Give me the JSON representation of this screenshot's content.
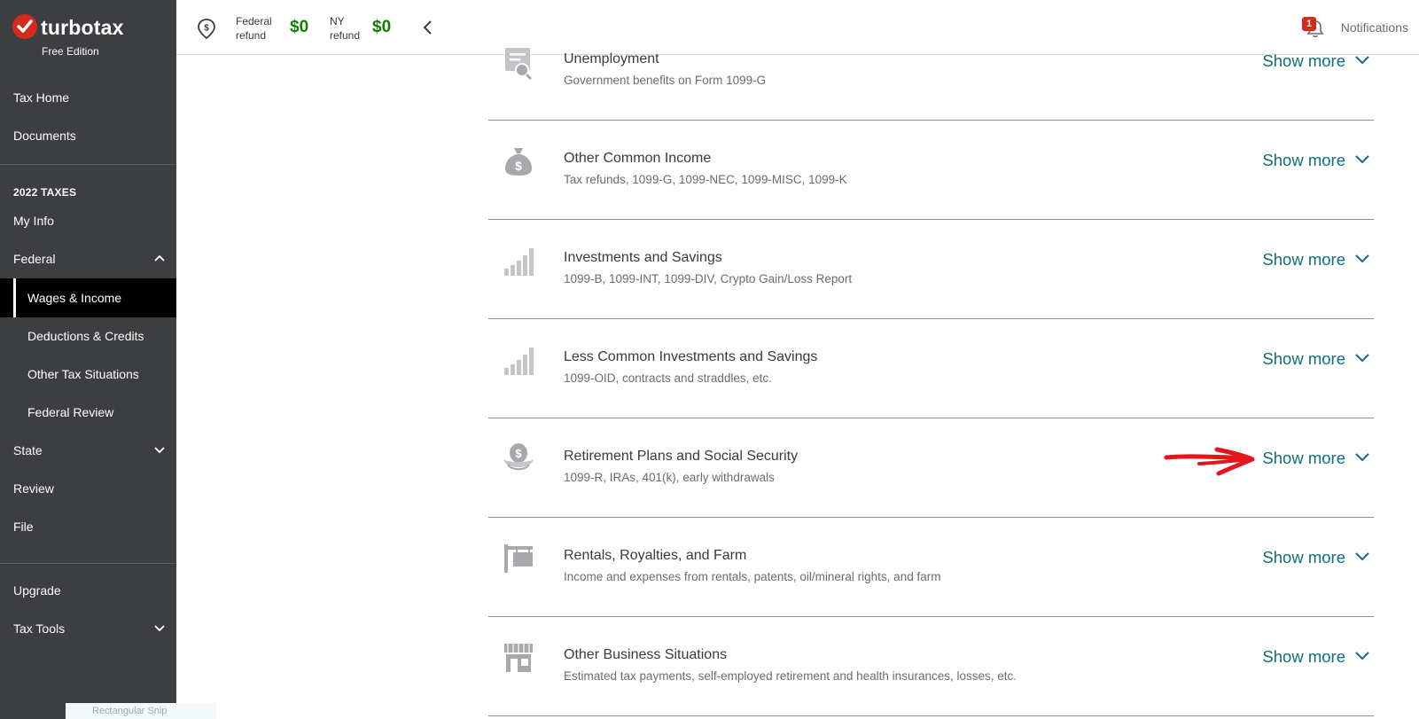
{
  "brand": {
    "logo_text": "turbotax",
    "edition": "Free Edition",
    "accent_color": "#d52b1e"
  },
  "sidebar": {
    "top_items": [
      {
        "label": "Tax Home"
      },
      {
        "label": "Documents"
      }
    ],
    "section_heading": "2022 TAXES",
    "items": [
      {
        "label": "My Info"
      },
      {
        "label": "Federal",
        "expanded": true
      },
      {
        "label": "Wages & Income",
        "active": true
      },
      {
        "label": "Deductions & Credits"
      },
      {
        "label": "Other Tax Situations"
      },
      {
        "label": "Federal Review"
      },
      {
        "label": "State",
        "expanded": false
      },
      {
        "label": "Review"
      },
      {
        "label": "File"
      }
    ],
    "bottom_items": [
      {
        "label": "Upgrade"
      },
      {
        "label": "Tax Tools",
        "expanded": false
      }
    ],
    "ghost_text": "Rectangular Snip"
  },
  "header": {
    "federal": {
      "label": "Federal refund",
      "amount": "$0"
    },
    "state": {
      "label": "NY refund",
      "amount": "$0"
    },
    "notifications": {
      "label": "Notifications",
      "count": "1"
    },
    "refund_color": "#108000"
  },
  "rows": [
    {
      "title": "Unemployment",
      "subtitle": "Government benefits on Form 1099-G",
      "action": "Show more",
      "icon": "certificate-search-icon"
    },
    {
      "title": "Other Common Income",
      "subtitle": "Tax refunds, 1099-G, 1099-NEC, 1099-MISC, 1099-K",
      "action": "Show more",
      "icon": "money-bag-icon"
    },
    {
      "title": "Investments and Savings",
      "subtitle": "1099-B, 1099-INT, 1099-DIV, Crypto Gain/Loss Report",
      "action": "Show more",
      "icon": "bar-growth-icon"
    },
    {
      "title": "Less Common Investments and Savings",
      "subtitle": "1099-OID, contracts and straddles, etc.",
      "action": "Show more",
      "icon": "bar-growth-icon"
    },
    {
      "title": "Retirement Plans and Social Security",
      "subtitle": "1099-R, IRAs, 401(k), early withdrawals",
      "action": "Show more",
      "icon": "nest-egg-icon"
    },
    {
      "title": "Rentals, Royalties, and Farm",
      "subtitle": "Income and expenses from rentals, patents, oil/mineral rights, and farm",
      "action": "Show more",
      "icon": "sign-post-icon"
    },
    {
      "title": "Other Business Situations",
      "subtitle": "Estimated tax payments, self-employed retirement and health insurances, losses, etc.",
      "action": "Show more",
      "icon": "storefront-icon"
    }
  ],
  "link_color": "#0d6f7a"
}
